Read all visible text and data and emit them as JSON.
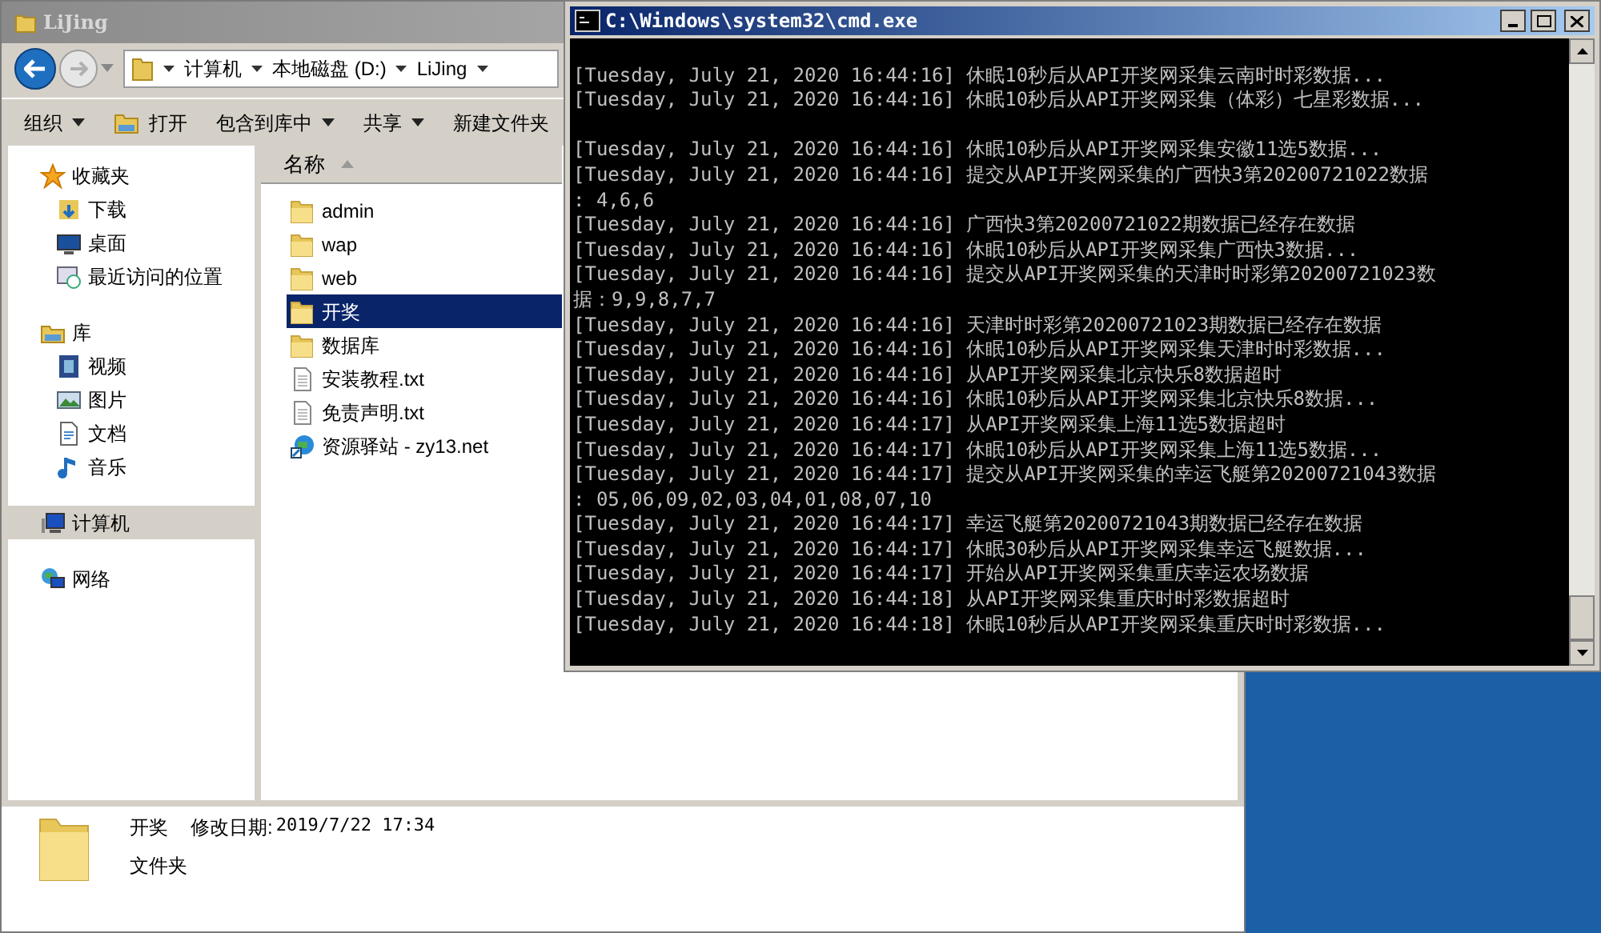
{
  "explorer": {
    "title": "LiJing",
    "breadcrumb": [
      "计算机",
      "本地磁盘 (D:)",
      "LiJing"
    ],
    "toolbar": [
      {
        "label": "组织",
        "dropdown": true
      },
      {
        "label": "打开",
        "dropdown": false,
        "kind": "open"
      },
      {
        "label": "包含到库中",
        "dropdown": true
      },
      {
        "label": "共享",
        "dropdown": true
      },
      {
        "label": "新建文件夹",
        "dropdown": false
      }
    ],
    "nav": [
      {
        "label": "收藏夹",
        "selected": false,
        "children": [
          {
            "label": "下载",
            "selected": false
          },
          {
            "label": "桌面",
            "selected": false
          },
          {
            "label": "最近访问的位置",
            "selected": false
          }
        ]
      },
      {
        "label": "库",
        "selected": false,
        "children": [
          {
            "label": "视频",
            "selected": false
          },
          {
            "label": "图片",
            "selected": false
          },
          {
            "label": "文档",
            "selected": false
          },
          {
            "label": "音乐",
            "selected": false
          }
        ]
      },
      {
        "label": "计算机",
        "selected": true
      },
      {
        "label": "网络",
        "selected": false
      }
    ],
    "column": "名称",
    "files": [
      {
        "name": "admin",
        "kind": "folder",
        "selected": false
      },
      {
        "name": "wap",
        "kind": "folder",
        "selected": false
      },
      {
        "name": "web",
        "kind": "folder",
        "selected": false
      },
      {
        "name": "开奖",
        "kind": "folder",
        "selected": true
      },
      {
        "name": "数据库",
        "kind": "folder",
        "selected": false
      },
      {
        "name": "安装教程.txt",
        "kind": "text",
        "selected": false
      },
      {
        "name": "免责声明.txt",
        "kind": "text",
        "selected": false
      },
      {
        "name": "资源驿站 - zy13.net",
        "kind": "shortcut",
        "selected": false
      }
    ],
    "details": {
      "name": "开奖",
      "date_label": "修改日期:",
      "date": "2019/7/22 17:34",
      "type": "文件夹"
    }
  },
  "console": {
    "title": "C:\\Windows\\system32\\cmd.exe",
    "blocks": [
      {
        "lines": [
          "[Tuesday, July 21, 2020 16:44:16] 休眠10秒后从API开奖网采集云南时时彩数据...",
          "[Tuesday, July 21, 2020 16:44:16] 休眠10秒后从API开奖网采集（体彩）七星彩数据..."
        ]
      },
      {
        "lines": [
          "[Tuesday, July 21, 2020 16:44:16] 休眠10秒后从API开奖网采集安徽11选5数据...",
          "[Tuesday, July 21, 2020 16:44:16] 提交从API开奖网采集的广西快3第20200721022数据",
          ": 4,6,6",
          "[Tuesday, July 21, 2020 16:44:16] 广西快3第20200721022期数据已经存在数据",
          "[Tuesday, July 21, 2020 16:44:16] 休眠10秒后从API开奖网采集广西快3数据...",
          "[Tuesday, July 21, 2020 16:44:16] 提交从API开奖网采集的天津时时彩第20200721023数",
          "据：9,9,8,7,7",
          "[Tuesday, July 21, 2020 16:44:16] 天津时时彩第20200721023期数据已经存在数据",
          "[Tuesday, July 21, 2020 16:44:16] 休眠10秒后从API开奖网采集天津时时彩数据...",
          "[Tuesday, July 21, 2020 16:44:16] 从API开奖网采集北京快乐8数据超时",
          "[Tuesday, July 21, 2020 16:44:16] 休眠10秒后从API开奖网采集北京快乐8数据...",
          "[Tuesday, July 21, 2020 16:44:17] 从API开奖网采集上海11选5数据超时",
          "[Tuesday, July 21, 2020 16:44:17] 休眠10秒后从API开奖网采集上海11选5数据...",
          "[Tuesday, July 21, 2020 16:44:17] 提交从API开奖网采集的幸运飞艇第20200721043数据",
          ": 05,06,09,02,03,04,01,08,07,10",
          "[Tuesday, July 21, 2020 16:44:17] 幸运飞艇第20200721043期数据已经存在数据",
          "[Tuesday, July 21, 2020 16:44:17] 休眠30秒后从API开奖网采集幸运飞艇数据...",
          "[Tuesday, July 21, 2020 16:44:17] 开始从API开奖网采集重庆幸运农场数据",
          "[Tuesday, July 21, 2020 16:44:18] 从API开奖网采集重庆时时彩数据超时",
          "[Tuesday, July 21, 2020 16:44:18] 休眠10秒后从API开奖网采集重庆时时彩数据..."
        ]
      }
    ]
  }
}
